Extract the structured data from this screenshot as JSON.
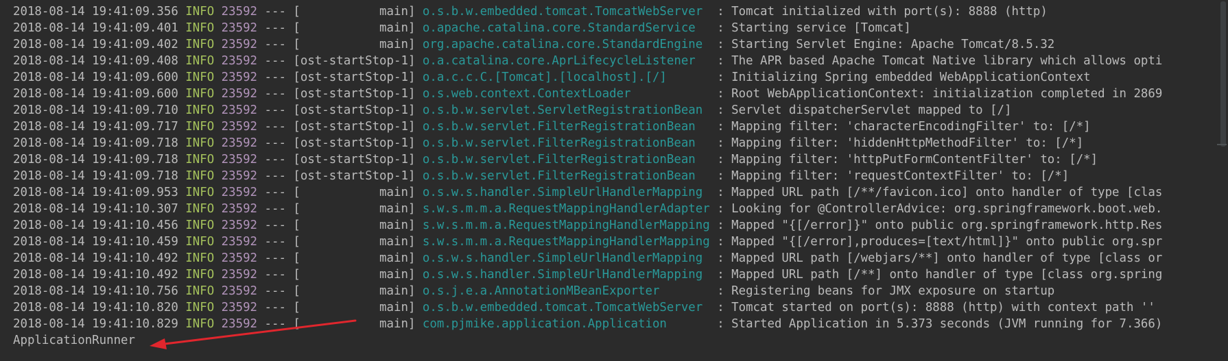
{
  "console": {
    "lines": [
      {
        "ts": "2018-08-14 19:41:09.356",
        "level": "INFO",
        "pid": "23592",
        "sep": "---",
        "thread": "[           main]",
        "logger": "o.s.b.w.embedded.tomcat.TomcatWebServer ",
        "msg": " : Tomcat initialized with port(s): 8888 (http)"
      },
      {
        "ts": "2018-08-14 19:41:09.401",
        "level": "INFO",
        "pid": "23592",
        "sep": "---",
        "thread": "[           main]",
        "logger": "o.apache.catalina.core.StandardService  ",
        "msg": " : Starting service [Tomcat]"
      },
      {
        "ts": "2018-08-14 19:41:09.402",
        "level": "INFO",
        "pid": "23592",
        "sep": "---",
        "thread": "[           main]",
        "logger": "org.apache.catalina.core.StandardEngine ",
        "msg": " : Starting Servlet Engine: Apache Tomcat/8.5.32"
      },
      {
        "ts": "2018-08-14 19:41:09.408",
        "level": "INFO",
        "pid": "23592",
        "sep": "---",
        "thread": "[ost-startStop-1]",
        "logger": "o.a.catalina.core.AprLifecycleListener  ",
        "msg": " : The APR based Apache Tomcat Native library which allows opti"
      },
      {
        "ts": "2018-08-14 19:41:09.600",
        "level": "INFO",
        "pid": "23592",
        "sep": "---",
        "thread": "[ost-startStop-1]",
        "logger": "o.a.c.c.C.[Tomcat].[localhost].[/]      ",
        "msg": " : Initializing Spring embedded WebApplicationContext"
      },
      {
        "ts": "2018-08-14 19:41:09.600",
        "level": "INFO",
        "pid": "23592",
        "sep": "---",
        "thread": "[ost-startStop-1]",
        "logger": "o.s.web.context.ContextLoader           ",
        "msg": " : Root WebApplicationContext: initialization completed in 2869"
      },
      {
        "ts": "2018-08-14 19:41:09.710",
        "level": "INFO",
        "pid": "23592",
        "sep": "---",
        "thread": "[ost-startStop-1]",
        "logger": "o.s.b.w.servlet.ServletRegistrationBean ",
        "msg": " : Servlet dispatcherServlet mapped to [/]"
      },
      {
        "ts": "2018-08-14 19:41:09.717",
        "level": "INFO",
        "pid": "23592",
        "sep": "---",
        "thread": "[ost-startStop-1]",
        "logger": "o.s.b.w.servlet.FilterRegistrationBean  ",
        "msg": " : Mapping filter: 'characterEncodingFilter' to: [/*]"
      },
      {
        "ts": "2018-08-14 19:41:09.718",
        "level": "INFO",
        "pid": "23592",
        "sep": "---",
        "thread": "[ost-startStop-1]",
        "logger": "o.s.b.w.servlet.FilterRegistrationBean  ",
        "msg": " : Mapping filter: 'hiddenHttpMethodFilter' to: [/*]"
      },
      {
        "ts": "2018-08-14 19:41:09.718",
        "level": "INFO",
        "pid": "23592",
        "sep": "---",
        "thread": "[ost-startStop-1]",
        "logger": "o.s.b.w.servlet.FilterRegistrationBean  ",
        "msg": " : Mapping filter: 'httpPutFormContentFilter' to: [/*]"
      },
      {
        "ts": "2018-08-14 19:41:09.718",
        "level": "INFO",
        "pid": "23592",
        "sep": "---",
        "thread": "[ost-startStop-1]",
        "logger": "o.s.b.w.servlet.FilterRegistrationBean  ",
        "msg": " : Mapping filter: 'requestContextFilter' to: [/*]"
      },
      {
        "ts": "2018-08-14 19:41:09.953",
        "level": "INFO",
        "pid": "23592",
        "sep": "---",
        "thread": "[           main]",
        "logger": "o.s.w.s.handler.SimpleUrlHandlerMapping ",
        "msg": " : Mapped URL path [/**/favicon.ico] onto handler of type [clas"
      },
      {
        "ts": "2018-08-14 19:41:10.307",
        "level": "INFO",
        "pid": "23592",
        "sep": "---",
        "thread": "[           main]",
        "logger": "s.w.s.m.m.a.RequestMappingHandlerAdapter",
        "msg": " : Looking for @ControllerAdvice: org.springframework.boot.web."
      },
      {
        "ts": "2018-08-14 19:41:10.456",
        "level": "INFO",
        "pid": "23592",
        "sep": "---",
        "thread": "[           main]",
        "logger": "s.w.s.m.m.a.RequestMappingHandlerMapping",
        "msg": " : Mapped \"{[/error]}\" onto public org.springframework.http.Res"
      },
      {
        "ts": "2018-08-14 19:41:10.459",
        "level": "INFO",
        "pid": "23592",
        "sep": "---",
        "thread": "[           main]",
        "logger": "s.w.s.m.m.a.RequestMappingHandlerMapping",
        "msg": " : Mapped \"{[/error],produces=[text/html]}\" onto public org.spr"
      },
      {
        "ts": "2018-08-14 19:41:10.492",
        "level": "INFO",
        "pid": "23592",
        "sep": "---",
        "thread": "[           main]",
        "logger": "o.s.w.s.handler.SimpleUrlHandlerMapping ",
        "msg": " : Mapped URL path [/webjars/**] onto handler of type [class or"
      },
      {
        "ts": "2018-08-14 19:41:10.492",
        "level": "INFO",
        "pid": "23592",
        "sep": "---",
        "thread": "[           main]",
        "logger": "o.s.w.s.handler.SimpleUrlHandlerMapping ",
        "msg": " : Mapped URL path [/**] onto handler of type [class org.spring"
      },
      {
        "ts": "2018-08-14 19:41:10.756",
        "level": "INFO",
        "pid": "23592",
        "sep": "---",
        "thread": "[           main]",
        "logger": "o.s.j.e.a.AnnotationMBeanExporter       ",
        "msg": " : Registering beans for JMX exposure on startup"
      },
      {
        "ts": "2018-08-14 19:41:10.820",
        "level": "INFO",
        "pid": "23592",
        "sep": "---",
        "thread": "[           main]",
        "logger": "o.s.b.w.embedded.tomcat.TomcatWebServer ",
        "msg": " : Tomcat started on port(s): 8888 (http) with context path ''"
      },
      {
        "ts": "2018-08-14 19:41:10.829",
        "level": "INFO",
        "pid": "23592",
        "sep": "---",
        "thread": "[           main]",
        "logger": "com.pjmike.application.Application      ",
        "msg": " : Started Application in 5.373 seconds (JVM running for 7.366)"
      }
    ],
    "output_line": "ApplicationRunner"
  },
  "colors": {
    "background": "#2b2b2b",
    "text": "#bbbbbb",
    "level_info": "#a5c25c",
    "pid": "#b294bb",
    "logger": "#299999",
    "annotation_arrow": "#e0262d"
  }
}
